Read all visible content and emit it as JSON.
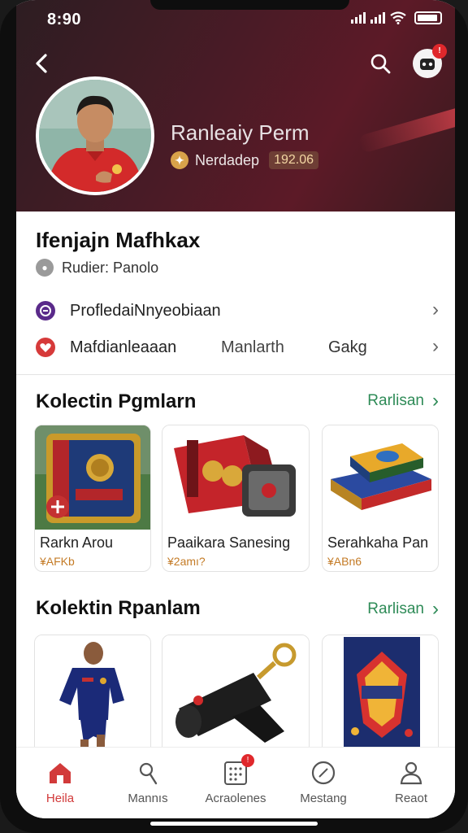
{
  "status": {
    "time": "8:90"
  },
  "header": {
    "profile_name": "Ranleaiy Perm",
    "badge_label": "Nerdadep",
    "badge_value": "192.06",
    "notification_count": "!"
  },
  "info": {
    "title": "Ifenjajn Mafhkax",
    "subtitle": "Rudier: Panolo",
    "rows": [
      {
        "label": "ProfledaiNnyeobiaan",
        "extra1": "",
        "extra2": ""
      },
      {
        "label": "Mafdianleaaan",
        "extra1": "Manlarth",
        "extra2": "Gakg"
      }
    ]
  },
  "section1": {
    "title": "Kolectin Pgmlarn",
    "see_all": "Rarlisan",
    "cards": [
      {
        "name": "Rarkn Arou",
        "price": "¥AFKb"
      },
      {
        "name": "Paaikara Sanesing",
        "price": "¥2amı?"
      },
      {
        "name": "Serahkaha Pan",
        "price": "¥ABn6"
      }
    ]
  },
  "section2": {
    "title": "Kolektin Rpanlam",
    "see_all": "Rarlisan"
  },
  "tabbar": {
    "items": [
      {
        "label": "Heila"
      },
      {
        "label": "Mannıs"
      },
      {
        "label": "Acraolenes",
        "badge": "!"
      },
      {
        "label": "Mestang"
      },
      {
        "label": "Reaot"
      }
    ]
  },
  "colors": {
    "accent_green": "#2e8b57",
    "active_red": "#d23a3a",
    "header_maroon": "#4a1b26"
  }
}
